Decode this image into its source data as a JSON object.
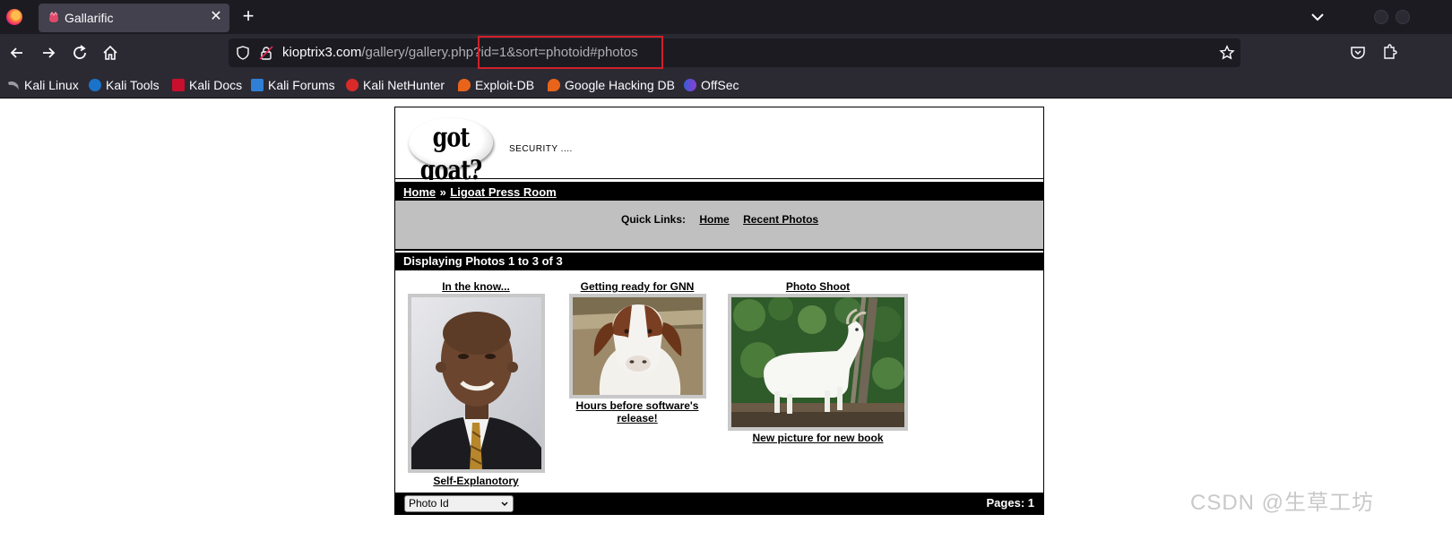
{
  "browser": {
    "tab_title": "Gallarific",
    "url_host": "kioptrix3.com",
    "url_path": "/gallery/gallery.php",
    "url_query": "?id=1&sort=photoid#photos",
    "bookmarks": [
      "Kali Linux",
      "Kali Tools",
      "Kali Docs",
      "Kali Forums",
      "Kali NetHunter",
      "Exploit-DB",
      "Google Hacking DB",
      "OffSec"
    ]
  },
  "page": {
    "logo_text": "got goat?",
    "tagline": "SECURITY ....",
    "breadcrumb": {
      "home": "Home",
      "separator": "»",
      "current": "Ligoat Press Room"
    },
    "quick_links": {
      "label": "Quick Links:",
      "home": "Home",
      "recent": "Recent Photos"
    },
    "display_text": "Displaying Photos 1 to 3 of 3",
    "photos": [
      {
        "title": "In the know...",
        "caption": "Self-Explanotory",
        "subject": "man-in-suit-portrait"
      },
      {
        "title": "Getting ready for GNN",
        "caption": "Hours before software's release!",
        "subject": "brown-white-goat"
      },
      {
        "title": "Photo Shoot",
        "caption": "New picture for new book",
        "subject": "white-goat-on-table"
      }
    ],
    "sort_value": "Photo Id",
    "pages": "Pages: 1"
  },
  "watermark": "CSDN @生草工坊",
  "colors": {
    "chrome_dark": "#1c1b22",
    "chrome": "#2b2a33",
    "url_highlight": "#d0202a",
    "quickbar": "#c0c0c0"
  }
}
